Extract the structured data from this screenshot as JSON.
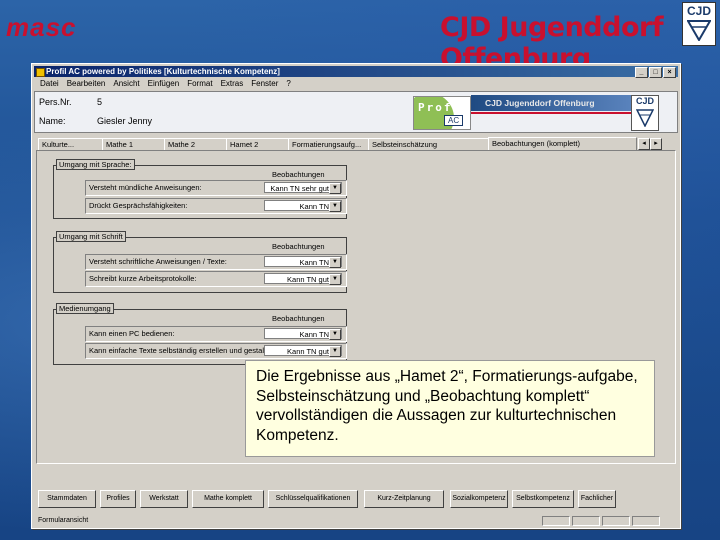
{
  "slide": {
    "brand_left": "masc",
    "brand_right": "CJD Jugenddorf Offenburg",
    "logo_text": "CJD",
    "callout_text": "Die Ergebnisse aus „Hamet 2“, Formatierungs-aufgabe, Selbsteinschätzung und „Beobachtung komplett“ vervollständigen die Aussagen zur kulturtechnischen Kompetenz."
  },
  "window": {
    "title": "Profil AC powered by Politikes   [Kulturtechnische Kompetenz]",
    "buttons": [
      "_",
      "□",
      "×"
    ],
    "menu": [
      "Datei",
      "Bearbeiten",
      "Ansicht",
      "Einfügen",
      "Format",
      "Extras",
      "Fenster",
      "?"
    ]
  },
  "person": {
    "pers_label": "Pers.Nr.",
    "pers_value": "5",
    "name_label": "Name:",
    "name_value": "Giesler Jenny",
    "profil_logo_text": "Profil",
    "profil_logo_sub": "AC",
    "banner_text": "CJD Jugenddorf Offenburg",
    "mini_logo_text": "CJD"
  },
  "tabs": [
    {
      "label": "Kulturte..."
    },
    {
      "label": "Mathe 1"
    },
    {
      "label": "Mathe 2"
    },
    {
      "label": "Hamet 2"
    },
    {
      "label": "Formatierungsaufg..."
    },
    {
      "label": "Selbsteinschätzung"
    },
    {
      "label": "Beobachtungen (komplett)"
    }
  ],
  "groups": [
    {
      "title": "Umgang mit Sprache:",
      "column": "Beobachtungen",
      "rows": [
        {
          "label": "Versteht mündliche Anweisungen:",
          "value": "Kann TN sehr gut"
        },
        {
          "label": "Drückt Gesprächsfähigkeiten:",
          "value": "Kann TN"
        }
      ]
    },
    {
      "title": "Umgang mit Schrift",
      "column": "Beobachtungen",
      "rows": [
        {
          "label": "Versteht schriftliche Anweisungen / Texte:",
          "value": "Kann TN"
        },
        {
          "label": "Schreibt kurze Arbeitsprotokolle:",
          "value": "Kann TN gut"
        }
      ]
    },
    {
      "title": "Medienumgang",
      "column": "Beobachtungen",
      "rows": [
        {
          "label": "Kann einen PC bedienen:",
          "value": "Kann TN"
        },
        {
          "label": "Kann einfache Texte selbständig erstellen und gestalten:",
          "value": "Kann TN gut"
        }
      ]
    }
  ],
  "bottom_buttons": [
    "Stammdaten",
    "Profiles",
    "Werkstatt",
    "Mathe komplett",
    "Schlüsselqualifikationen",
    "Kurz-Zeitplanung",
    "Sozialkompetenz",
    "Selbstkompetenz",
    "Fachlicher"
  ],
  "status": {
    "text": "Formularansicht"
  },
  "colors": {
    "brand_red": "#c9102e",
    "slide_blue": "#1d4f92",
    "callout_bg": "#ffffe0",
    "window_gray": "#d4d0c8",
    "titlebar": "#0a246a"
  }
}
